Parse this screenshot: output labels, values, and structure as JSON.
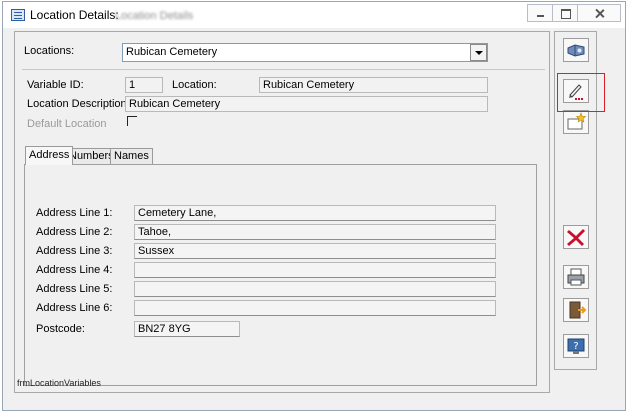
{
  "window": {
    "title": "Location Details:",
    "title_suffix": "Location Details"
  },
  "form": {
    "locations_label": "Locations:",
    "locations_value": "Rubican Cemetery",
    "variable_id_label": "Variable ID:",
    "variable_id_value": "1",
    "location_label": "Location:",
    "location_value": "Rubican Cemetery",
    "description_label": "Location Description:",
    "description_value": "Rubican Cemetery",
    "default_location_label": "Default Location",
    "default_location_checked": false
  },
  "tabs": [
    {
      "label": "Address",
      "active": true
    },
    {
      "label": "Numbers",
      "active": false
    },
    {
      "label": "Names",
      "active": false
    }
  ],
  "address": {
    "lines": [
      {
        "label": "Address Line 1:",
        "value": "Cemetery Lane,"
      },
      {
        "label": "Address Line 2:",
        "value": "Tahoe,"
      },
      {
        "label": "Address Line 3:",
        "value": "Sussex"
      },
      {
        "label": "Address Line 4:",
        "value": ""
      },
      {
        "label": "Address Line 5:",
        "value": ""
      },
      {
        "label": "Address Line 6:",
        "value": ""
      }
    ],
    "postcode_label": "Postcode:",
    "postcode_value": "BN27 8YG"
  },
  "toolbar": {
    "icons": [
      "view-icon",
      "edit-icon",
      "new-icon",
      "delete-icon",
      "print-icon",
      "exit-icon",
      "help-icon"
    ],
    "delete_color": "#c8102e",
    "highlight_color": "#d9202b"
  },
  "footer": {
    "form_name": "frmLocationVariables"
  }
}
